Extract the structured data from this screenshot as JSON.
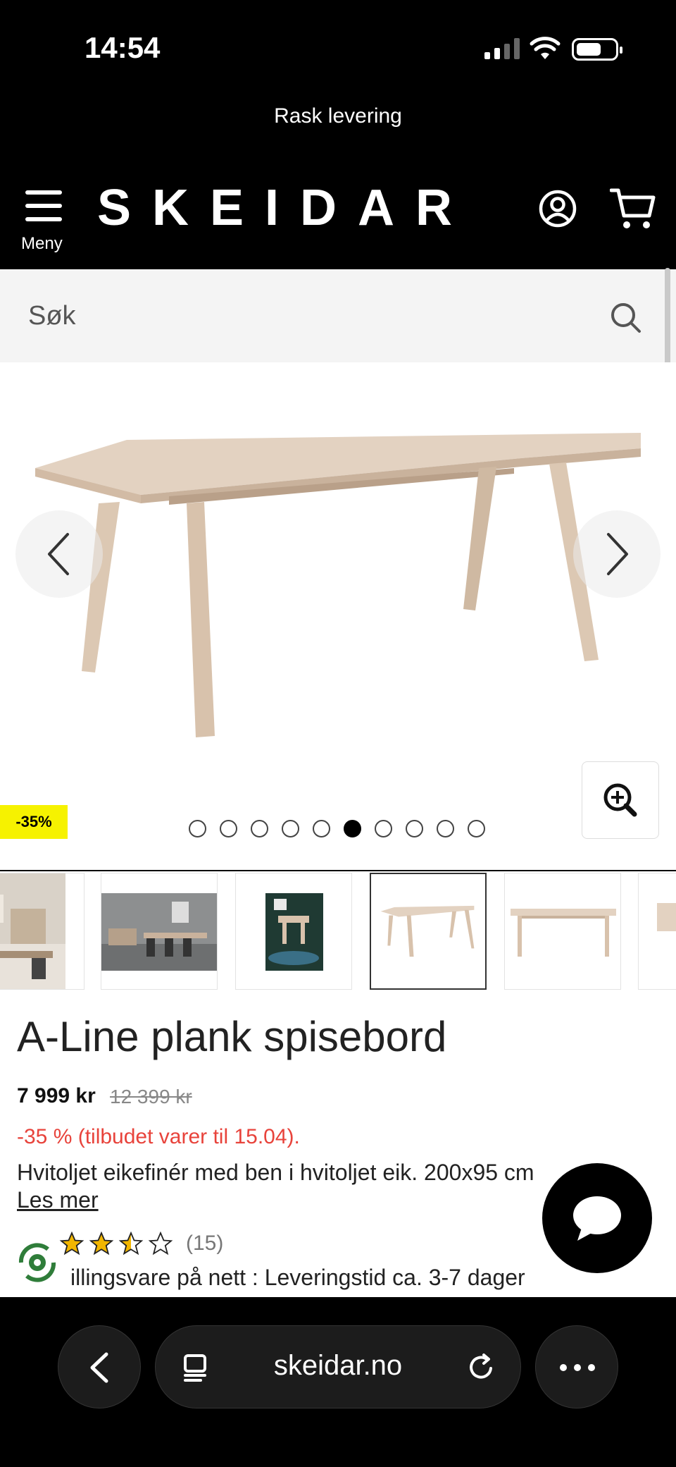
{
  "status_bar": {
    "time": "14:54"
  },
  "promo_banner": "Rask levering",
  "header": {
    "menu_label": "Meny",
    "logo": "SKEIDAR"
  },
  "search": {
    "placeholder": "Søk"
  },
  "gallery": {
    "discount_badge": "-35%",
    "dots_total": 10,
    "active_dot_index": 5,
    "thumbnails": [
      "interior-1",
      "interior-2",
      "interior-3",
      "table-angle",
      "table-front",
      "table-partial"
    ],
    "selected_thumbnail": 3
  },
  "product": {
    "title": "A-Line plank spisebord",
    "price_current": "7 999 kr",
    "price_old": "12 399 kr",
    "offer": "-35 % (tilbudet varer til 15.04).",
    "description": "Hvitoljet eikefinér med ben i hvitoljet eik. 200x95 cm",
    "read_more": "Les mer",
    "rating_stars": 2.5,
    "rating_count": "(15)",
    "delivery": "illingsvare på nett : Leveringstid ca. 3-7 dager"
  },
  "browser": {
    "url": "skeidar.no"
  },
  "colors": {
    "accent_red": "#e8433b",
    "badge_yellow": "#f6f200",
    "star_gold": "#f2b600"
  }
}
